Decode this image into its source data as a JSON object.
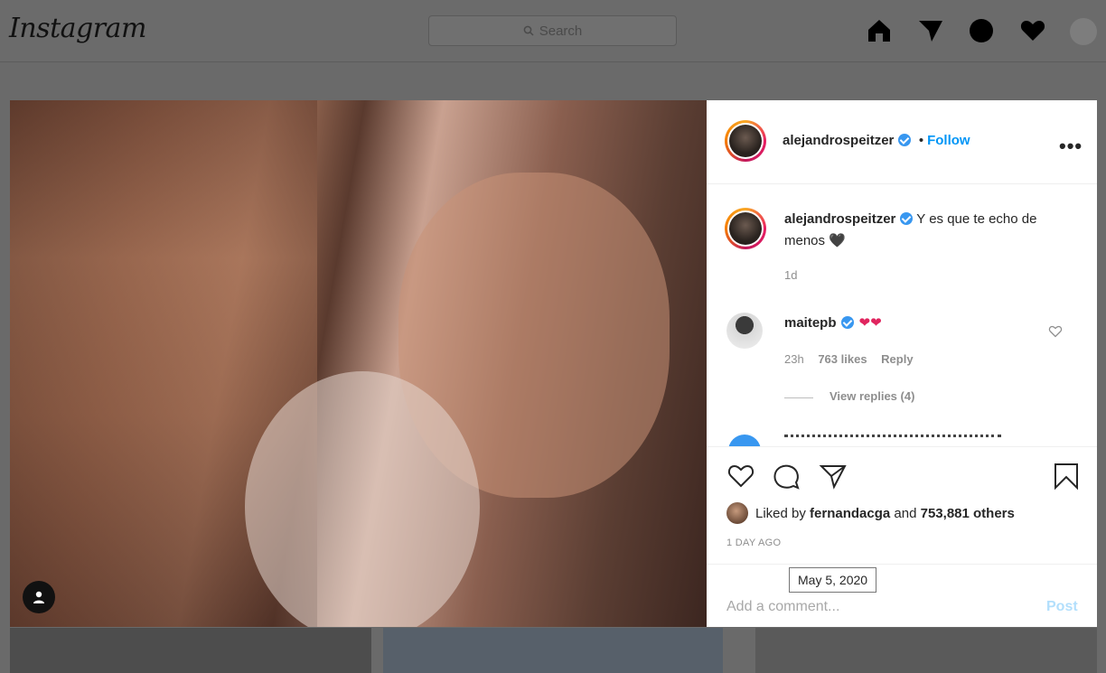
{
  "header": {
    "logo": "Instagram",
    "search_placeholder": "Search"
  },
  "post": {
    "username": "alejandrospeitzer",
    "follow_label": "Follow",
    "separator": "•",
    "caption_text": "Y es que te echo de menos 🖤",
    "caption_age": "1d"
  },
  "comments": [
    {
      "username": "maitepb",
      "text": "❤❤",
      "age": "23h",
      "likes": "763 likes",
      "reply_label": "Reply",
      "view_replies": "View replies (4)"
    }
  ],
  "likes": {
    "prefix": "Liked by",
    "user": "fernandacga",
    "and": "and",
    "others": "753,881 others"
  },
  "time_ago": "1 DAY AGO",
  "tooltip": "May 5, 2020",
  "comment_input": {
    "placeholder": "Add a comment...",
    "post_label": "Post"
  },
  "colors": {
    "accent": "#0095f6",
    "verified": "#3897f0",
    "overlay": "#6a6a6a",
    "heart": "#e0245e"
  },
  "icons": [
    "search-icon",
    "home-icon",
    "direct-icon",
    "explore-icon",
    "activity-heart-icon",
    "profile-avatar",
    "like-icon",
    "comment-icon",
    "share-icon",
    "save-icon",
    "user-tag-icon",
    "more-options-icon",
    "verified-badge-icon"
  ]
}
